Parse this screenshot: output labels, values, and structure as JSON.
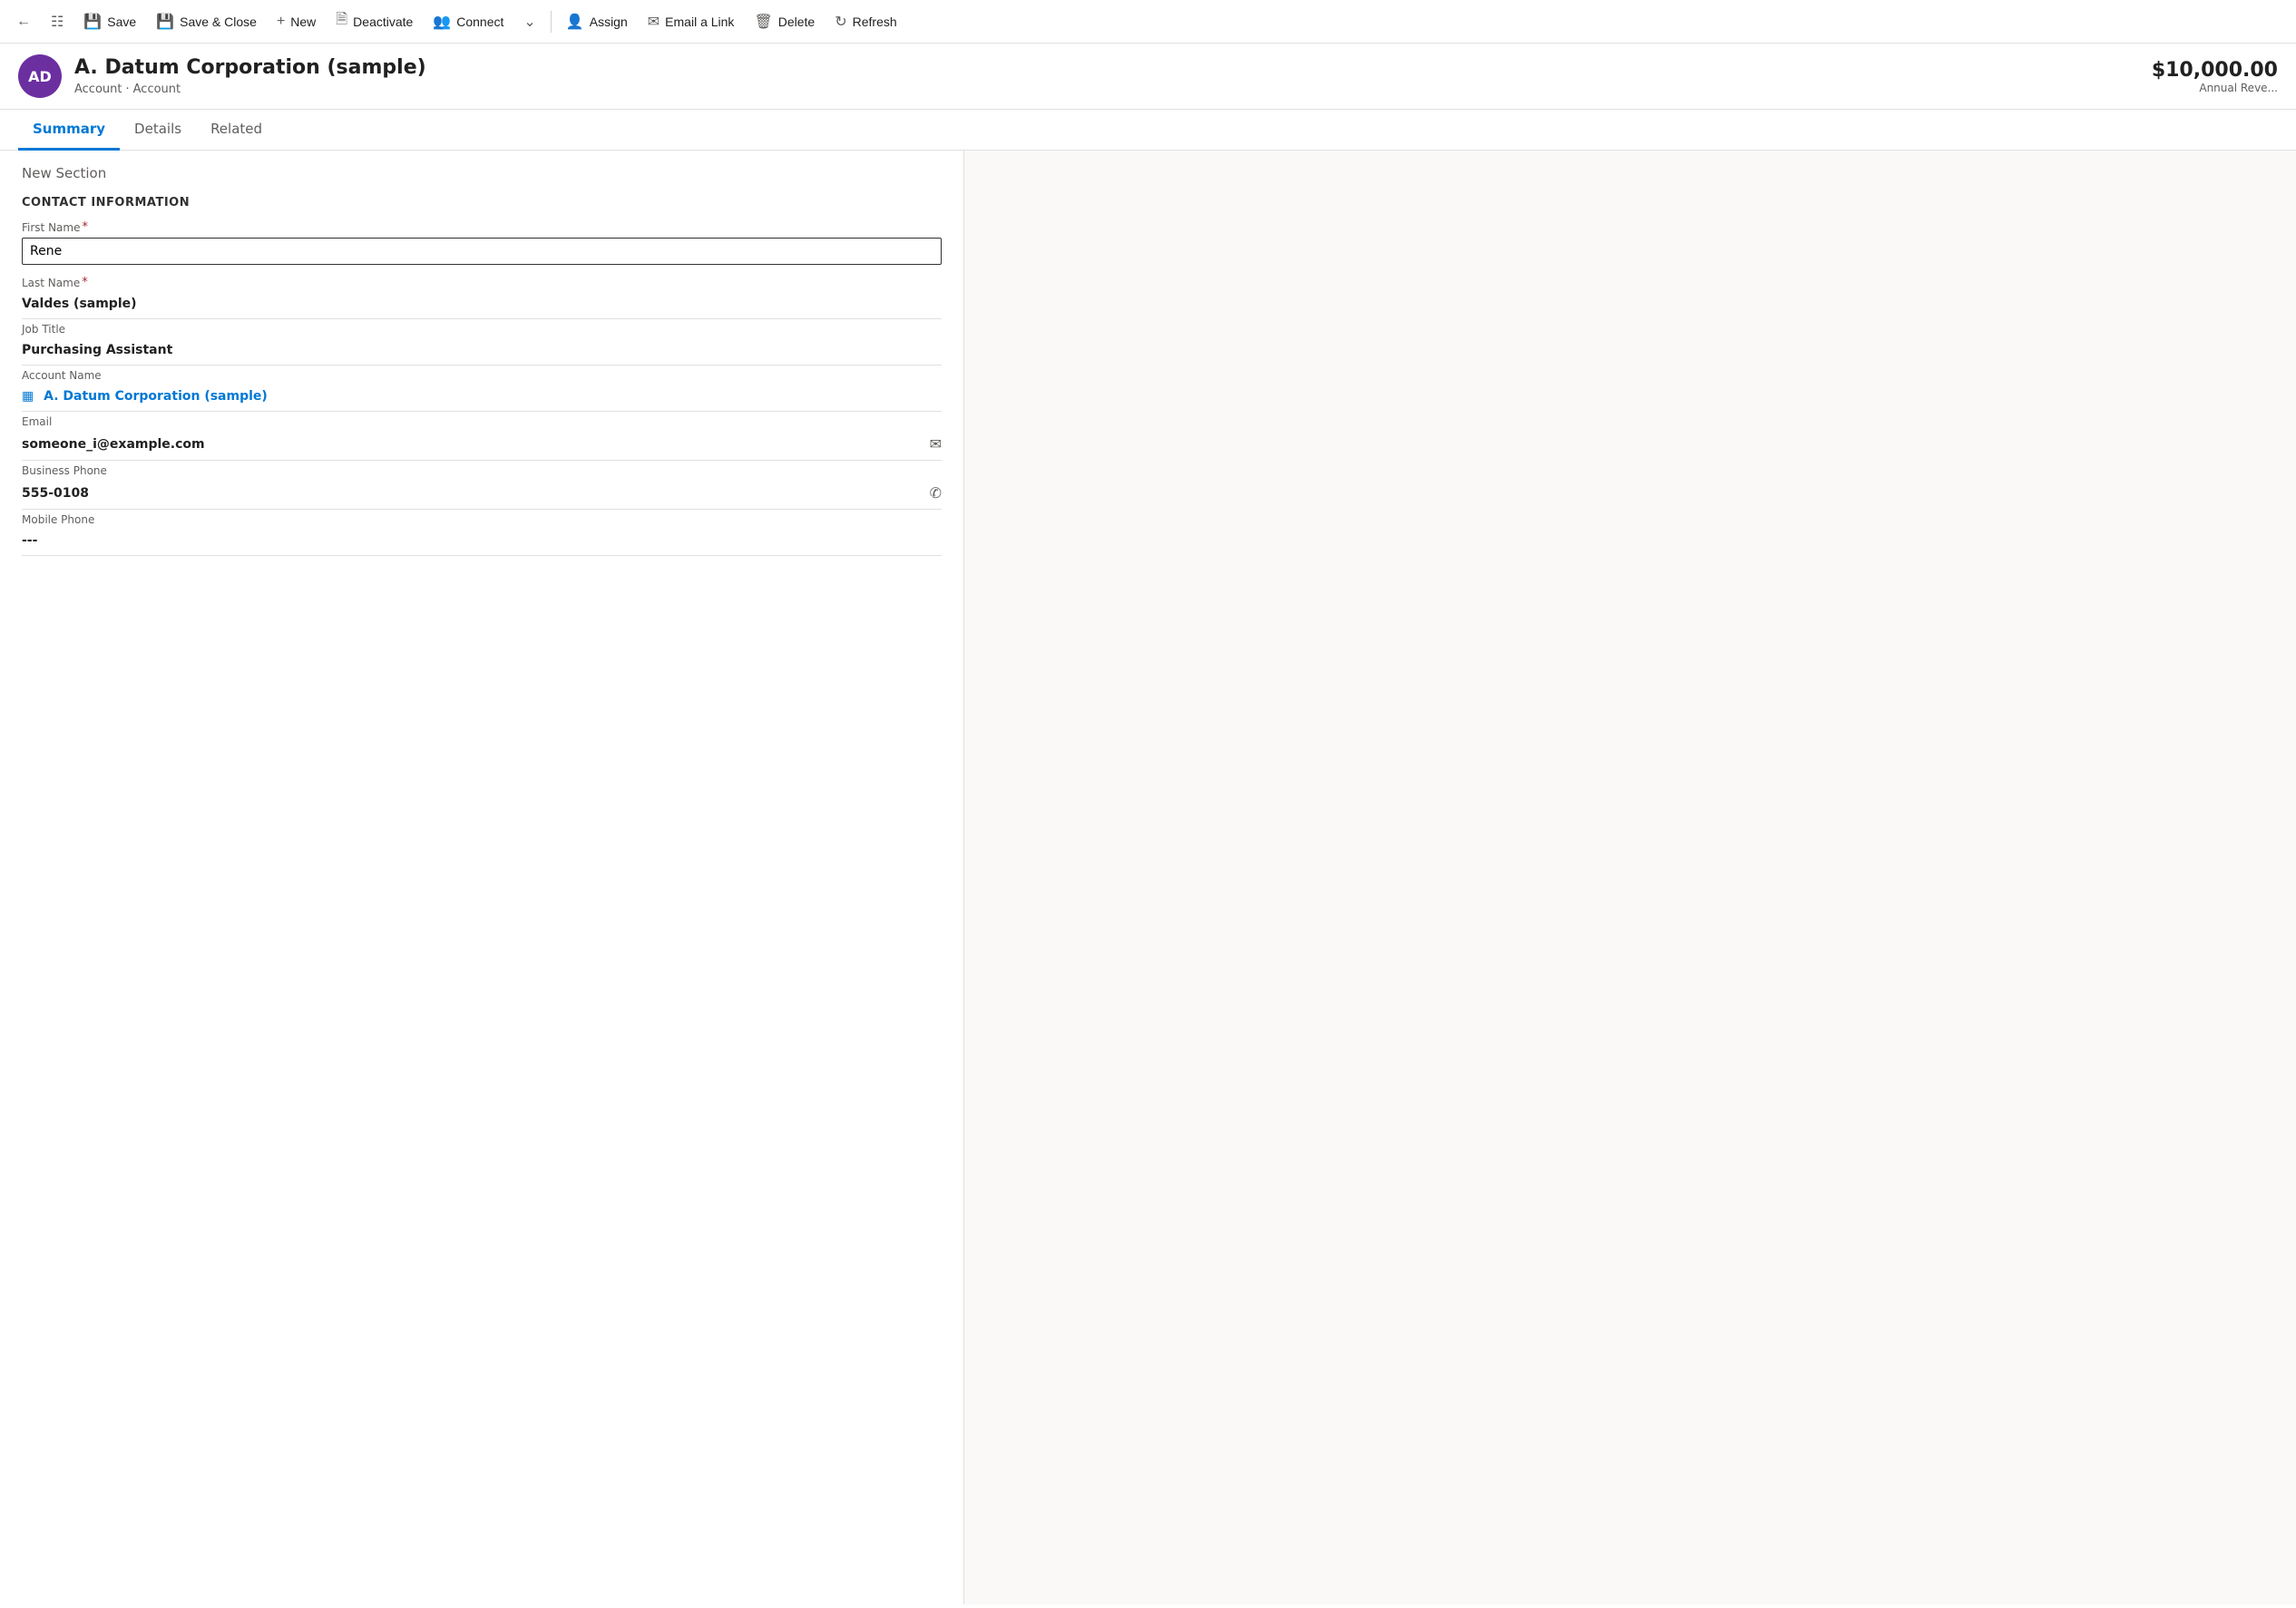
{
  "toolbar": {
    "back_icon": "←",
    "nav_icon": "☰",
    "save_label": "Save",
    "save_close_label": "Save & Close",
    "new_label": "New",
    "deactivate_label": "Deactivate",
    "connect_label": "Connect",
    "more_icon": "∨",
    "assign_label": "Assign",
    "email_link_label": "Email a Link",
    "delete_label": "Delete",
    "refresh_label": "Refresh"
  },
  "record": {
    "avatar_initials": "AD",
    "avatar_bg": "#6b2fa0",
    "title": "A. Datum Corporation (sample)",
    "breadcrumb1": "Account",
    "breadcrumb2": "Account",
    "annual_revenue": "$10,000.00",
    "annual_revenue_label": "Annual Reve..."
  },
  "tabs": [
    {
      "label": "Summary",
      "active": true
    },
    {
      "label": "Details",
      "active": false
    },
    {
      "label": "Related",
      "active": false
    }
  ],
  "form": {
    "new_section_label": "New Section",
    "contact_info_heading": "CONTACT INFORMATION",
    "fields": [
      {
        "label": "First Name",
        "required": true,
        "type": "input",
        "value": "Rene"
      },
      {
        "label": "Last Name",
        "required": true,
        "type": "text",
        "value": "Valdes (sample)"
      },
      {
        "label": "Job Title",
        "required": false,
        "type": "text",
        "value": "Purchasing Assistant"
      },
      {
        "label": "Account Name",
        "required": false,
        "type": "link",
        "value": "A. Datum Corporation (sample)"
      },
      {
        "label": "Email",
        "required": false,
        "type": "email",
        "value": "someone_i@example.com"
      },
      {
        "label": "Business Phone",
        "required": false,
        "type": "phone",
        "value": "555-0108"
      },
      {
        "label": "Mobile Phone",
        "required": false,
        "type": "text",
        "value": "---"
      }
    ]
  }
}
